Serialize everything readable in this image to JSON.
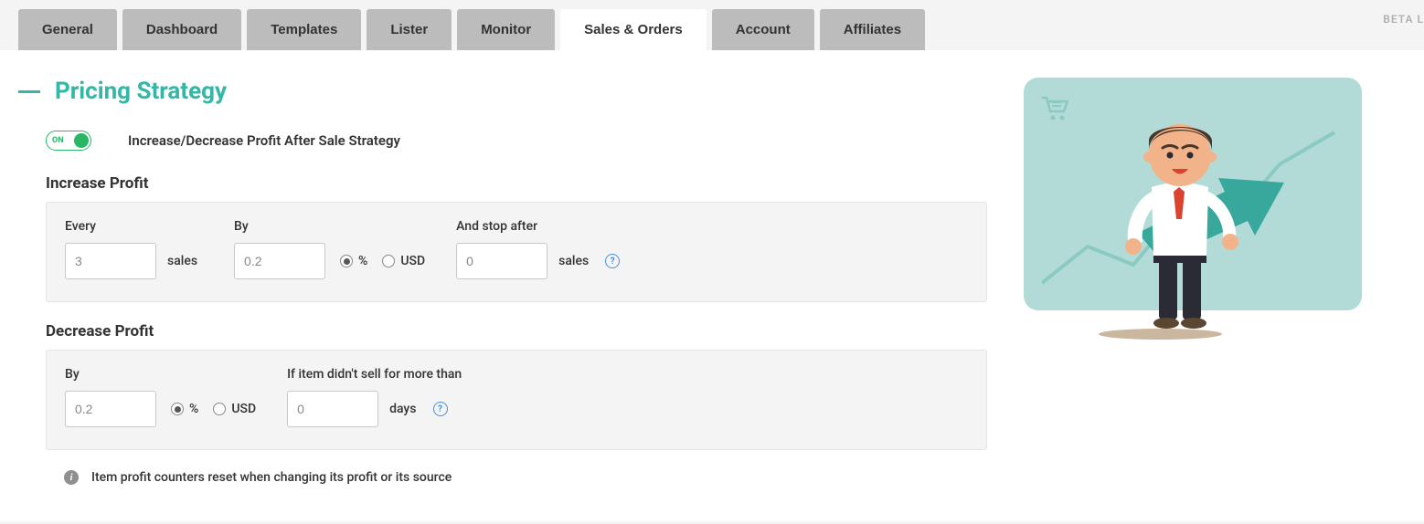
{
  "beta": "BETA L",
  "tabs": [
    {
      "label": "General",
      "active": false
    },
    {
      "label": "Dashboard",
      "active": false
    },
    {
      "label": "Templates",
      "active": false
    },
    {
      "label": "Lister",
      "active": false
    },
    {
      "label": "Monitor",
      "active": false
    },
    {
      "label": "Sales & Orders",
      "active": true
    },
    {
      "label": "Account",
      "active": false
    },
    {
      "label": "Affiliates",
      "active": false
    }
  ],
  "section": {
    "title": "Pricing Strategy",
    "toggle_on_label": "ON",
    "toggle_desc": "Increase/Decrease Profit After Sale Strategy"
  },
  "increase": {
    "title": "Increase Profit",
    "every_label": "Every",
    "every_value": "3",
    "every_unit": "sales",
    "by_label": "By",
    "by_value": "0.2",
    "unit_percent": "%",
    "unit_usd": "USD",
    "stop_label": "And stop after",
    "stop_value": "0",
    "stop_unit": "sales"
  },
  "decrease": {
    "title": "Decrease Profit",
    "by_label": "By",
    "by_value": "0.2",
    "unit_percent": "%",
    "unit_usd": "USD",
    "nosale_label": "If item didn't sell for more than",
    "nosale_value": "0",
    "nosale_unit": "days"
  },
  "note": "Item profit counters reset when changing its profit or its source"
}
